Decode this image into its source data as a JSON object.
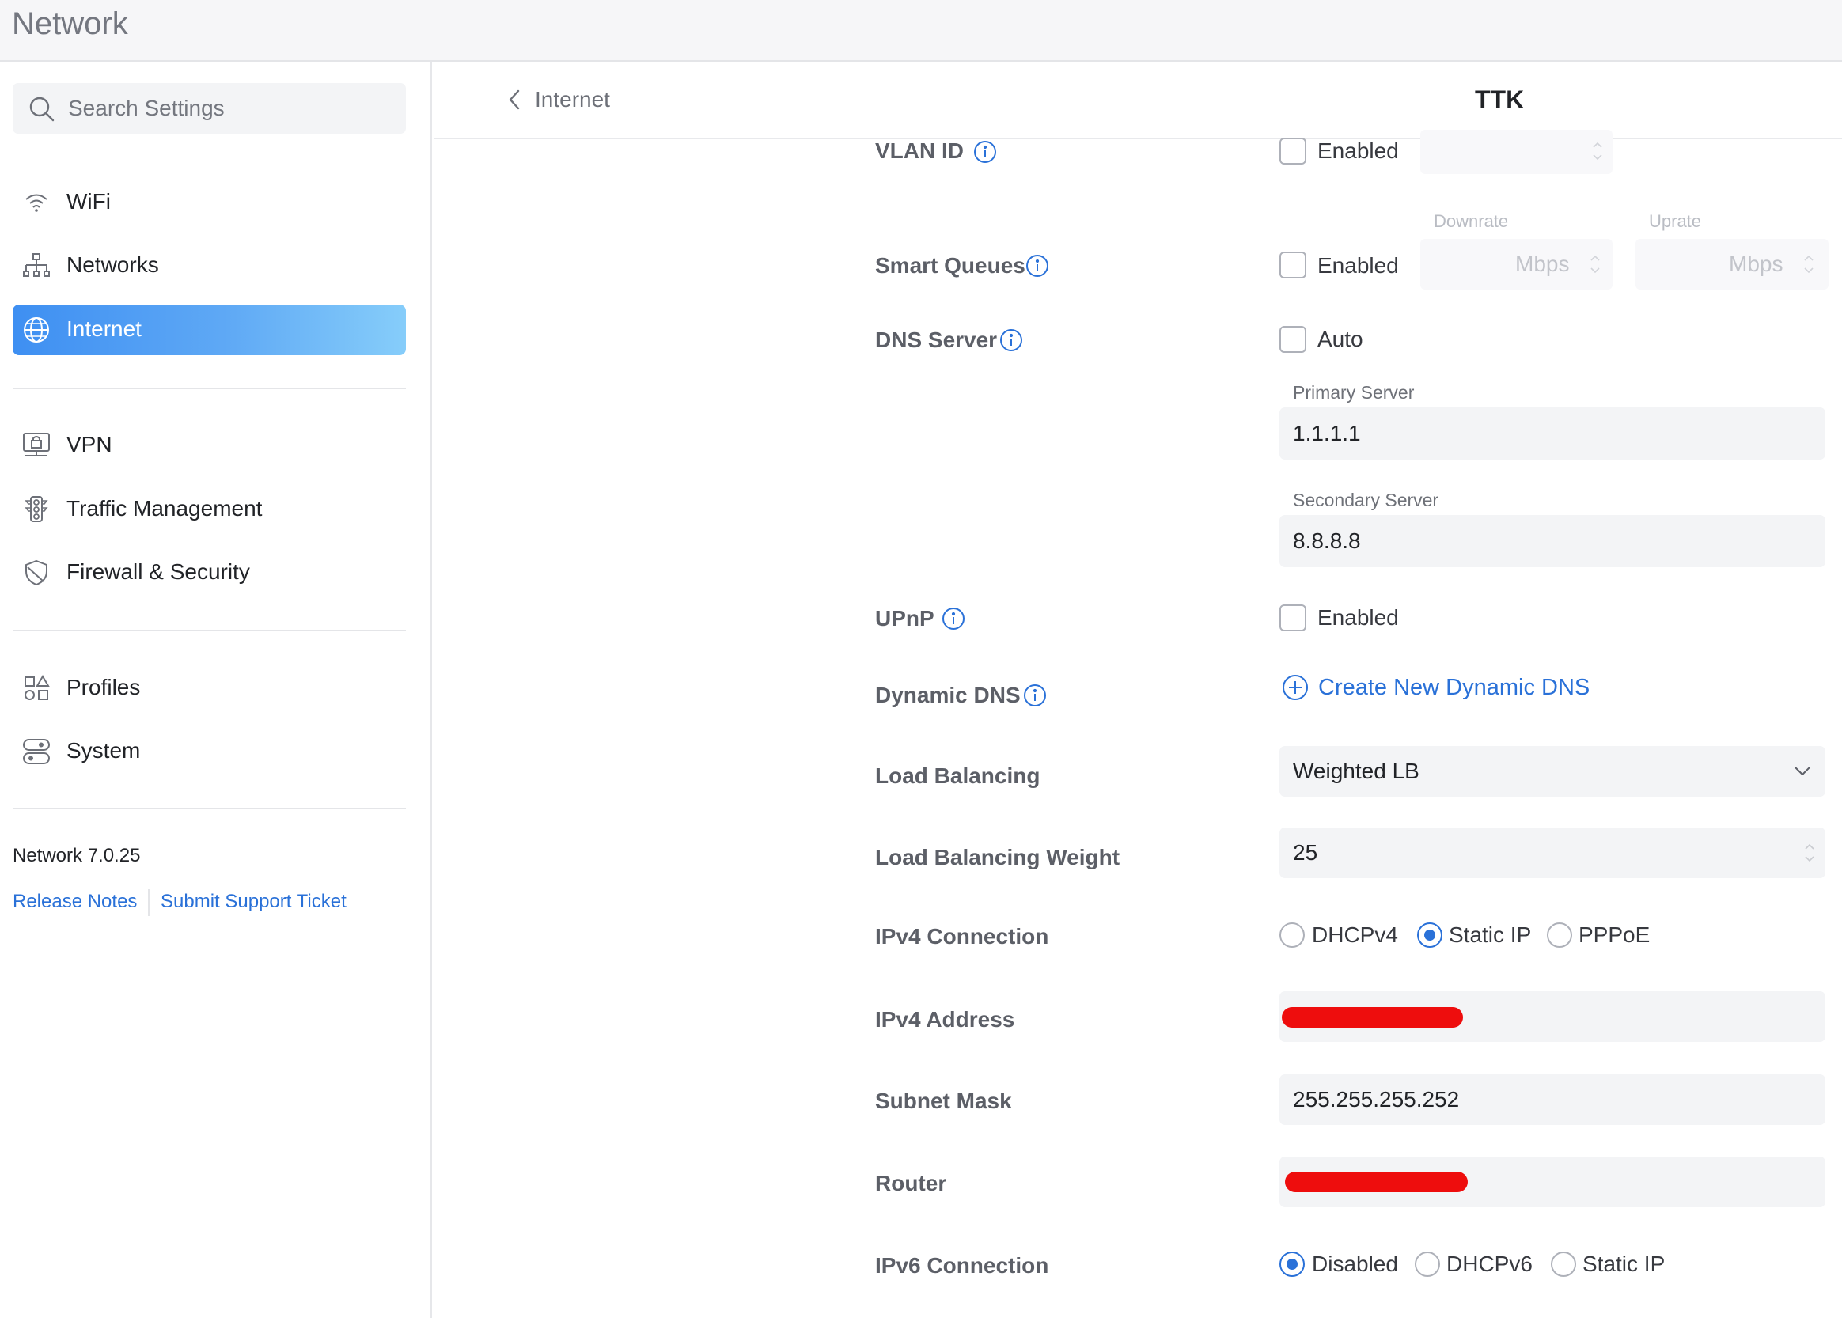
{
  "app": {
    "title": "Network"
  },
  "sidebar": {
    "search_placeholder": "Search Settings",
    "items": [
      {
        "label": "WiFi",
        "icon": "wifi-icon"
      },
      {
        "label": "Networks",
        "icon": "network-topology-icon"
      },
      {
        "label": "Internet",
        "icon": "globe-icon",
        "active": true
      },
      {
        "label": "VPN",
        "icon": "vpn-lock-icon"
      },
      {
        "label": "Traffic Management",
        "icon": "traffic-light-icon"
      },
      {
        "label": "Firewall & Security",
        "icon": "shield-icon"
      },
      {
        "label": "Profiles",
        "icon": "profiles-grid-icon"
      },
      {
        "label": "System",
        "icon": "system-toggles-icon"
      }
    ],
    "version": "Network 7.0.25",
    "links": {
      "release_notes": "Release Notes",
      "support": "Submit Support Ticket"
    }
  },
  "header": {
    "back_label": "Internet",
    "title": "TTK"
  },
  "form": {
    "vlan": {
      "label": "VLAN ID",
      "checkbox": "Enabled",
      "checked": false
    },
    "smart_queues": {
      "label": "Smart Queues",
      "checkbox": "Enabled",
      "checked": false,
      "downrate_label": "Downrate",
      "uprate_label": "Uprate",
      "down_unit": "Mbps",
      "up_unit": "Mbps"
    },
    "dns": {
      "label": "DNS Server",
      "checkbox": "Auto",
      "checked": false,
      "primary_label": "Primary Server",
      "primary": "1.1.1.1",
      "secondary_label": "Secondary Server",
      "secondary": "8.8.8.8"
    },
    "upnp": {
      "label": "UPnP",
      "checkbox": "Enabled",
      "checked": false
    },
    "dynamic_dns": {
      "label": "Dynamic DNS",
      "action": "Create New Dynamic DNS"
    },
    "load_balancing": {
      "label": "Load Balancing",
      "value": "Weighted LB"
    },
    "lb_weight": {
      "label": "Load Balancing Weight",
      "value": "25"
    },
    "ipv4_connection": {
      "label": "IPv4 Connection",
      "options": [
        "DHCPv4",
        "Static IP",
        "PPPoE"
      ],
      "selected": "Static IP"
    },
    "ipv4_address": {
      "label": "IPv4 Address"
    },
    "subnet_mask": {
      "label": "Subnet Mask",
      "value": "255.255.255.252"
    },
    "router": {
      "label": "Router"
    },
    "ipv6_connection": {
      "label": "IPv6 Connection",
      "options": [
        "Disabled",
        "DHCPv6",
        "Static IP"
      ],
      "selected": "Disabled"
    }
  },
  "colors": {
    "accent": "#2a71d8",
    "redaction": "#ee0d0d",
    "active_nav_start": "#3e8ff2",
    "active_nav_end": "#86cdfa"
  }
}
